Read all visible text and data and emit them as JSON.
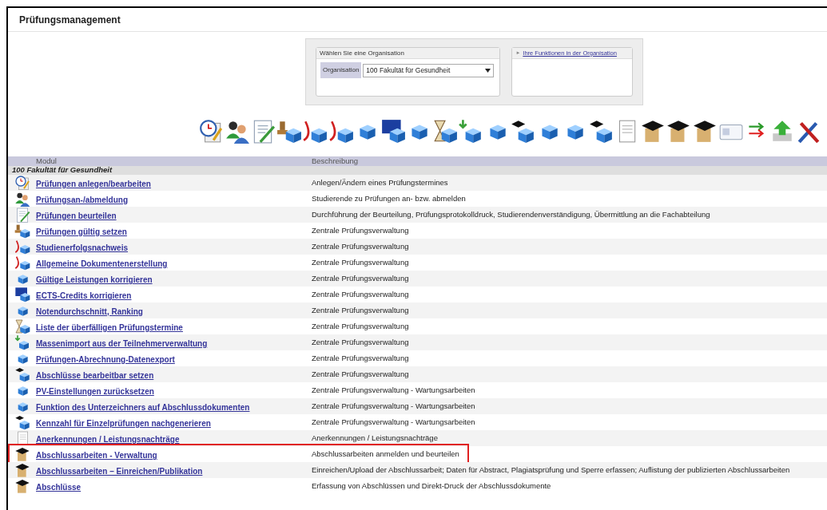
{
  "title": "Prüfungsmanagement",
  "organisation_panel": {
    "heading": "Wählen Sie eine Organisation",
    "label": "Organisation",
    "value": "100 Fakultät für Gesundheit",
    "functions_link": "Ihre Funktionen in der Organisation",
    "functions_arrow": "►"
  },
  "table": {
    "columns": [
      "Modul",
      "Beschreibung"
    ],
    "group": "100 Fakultät für Gesundheit",
    "rows": [
      {
        "module": "Prüfungen anlegen/bearbeiten",
        "description": "Anlegen/Ändern eines Prüfungstermines",
        "highlighted": false
      },
      {
        "module": "Prüfungsan-/abmeldung",
        "description": "Studierende zu Prüfungen an- bzw. abmelden",
        "highlighted": false
      },
      {
        "module": "Prüfungen beurteilen",
        "description": "Durchführung der Beurteilung, Prüfungsprotokolldruck, Studierendenverständigung, Übermittlung an die Fachabteilung",
        "highlighted": false
      },
      {
        "module": "Prüfungen gültig setzen",
        "description": "Zentrale Prüfungsverwaltung",
        "highlighted": false
      },
      {
        "module": "Studienerfolgsnachweis",
        "description": "Zentrale Prüfungsverwaltung",
        "highlighted": false
      },
      {
        "module": "Allgemeine Dokumentenerstellung",
        "description": "Zentrale Prüfungsverwaltung",
        "highlighted": false
      },
      {
        "module": "Gültige Leistungen korrigieren",
        "description": "Zentrale Prüfungsverwaltung",
        "highlighted": false
      },
      {
        "module": "ECTS-Credits korrigieren",
        "description": "Zentrale Prüfungsverwaltung",
        "highlighted": false
      },
      {
        "module": "Notendurchschnitt, Ranking",
        "description": "Zentrale Prüfungsverwaltung",
        "highlighted": false
      },
      {
        "module": "Liste der überfälligen Prüfungstermine",
        "description": "Zentrale Prüfungsverwaltung",
        "highlighted": false
      },
      {
        "module": "Massenimport aus der Teilnehmerverwaltung",
        "description": "Zentrale Prüfungsverwaltung",
        "highlighted": false
      },
      {
        "module": "Prüfungen-Abrechnung-Datenexport",
        "description": "Zentrale Prüfungsverwaltung",
        "highlighted": false
      },
      {
        "module": "Abschlüsse bearbeitbar setzen",
        "description": "Zentrale Prüfungsverwaltung",
        "highlighted": false
      },
      {
        "module": "PV-Einstellungen zurücksetzen",
        "description": "Zentrale Prüfungsverwaltung - Wartungsarbeiten",
        "highlighted": false
      },
      {
        "module": "Funktion des Unterzeichners auf Abschlussdokumenten",
        "description": "Zentrale Prüfungsverwaltung - Wartungsarbeiten",
        "highlighted": false
      },
      {
        "module": "Kennzahl für Einzelprüfungen nachgenerieren",
        "description": "Zentrale Prüfungsverwaltung - Wartungsarbeiten",
        "highlighted": false
      },
      {
        "module": "Anerkennungen / Leistungsnachträge",
        "description": "Anerkennungen / Leistungsnachträge",
        "highlighted": false
      },
      {
        "module": "Abschlussarbeiten - Verwaltung",
        "description": "Abschlussarbeiten anmelden und beurteilen",
        "highlighted": true
      },
      {
        "module": "Abschlussarbeiten – Einreichen/Publikation",
        "description": "Einreichen/Upload der Abschlussarbeit; Daten für Abstract, Plagiatsprüfung und Sperre erfassen; Auflistung der publizierten Abschlussarbeiten",
        "highlighted": false
      },
      {
        "module": "Abschlüsse",
        "description": "Erfassung von Abschlüssen und Direkt-Druck der Abschlussdokumente",
        "highlighted": false
      }
    ]
  }
}
